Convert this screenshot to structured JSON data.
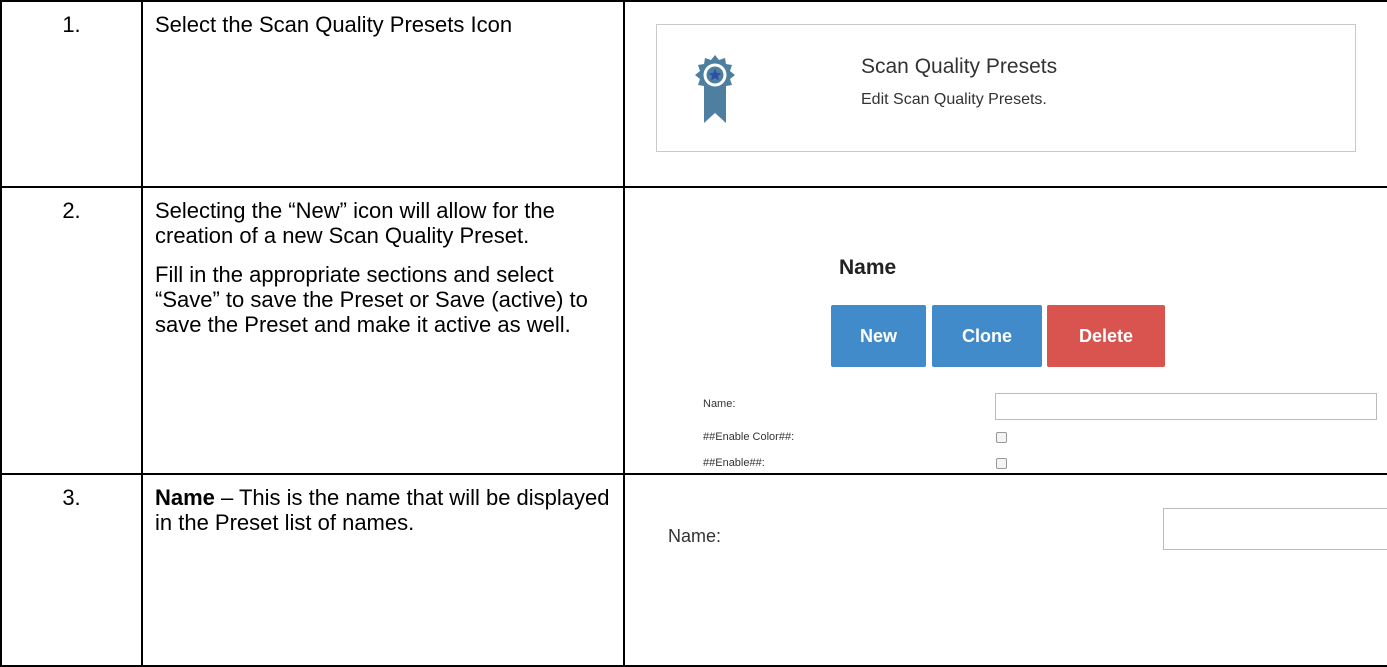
{
  "rows": [
    {
      "num": "1.",
      "desc": "Select the Scan Quality Presets Icon",
      "card": {
        "title": "Scan Quality Presets",
        "subtitle": "Edit Scan Quality Presets.",
        "icon": "ribbon-star-badge-icon"
      }
    },
    {
      "num": "2.",
      "desc_p1": "Selecting the “New” icon will allow for the creation of a new Scan Quality Preset.",
      "desc_p2": "Fill in the appropriate sections and select “Save” to save the Preset or Save (active) to save the Preset and make it active as well.",
      "form": {
        "heading": "Name",
        "buttons": {
          "new": "New",
          "clone": "Clone",
          "delete": "Delete"
        },
        "fields": {
          "name": "Name:",
          "enable_color": "##Enable Color##:",
          "enable": "##Enable##:"
        }
      }
    },
    {
      "num": "3.",
      "desc_bold": "Name",
      "desc_rest": " – This is the name that will be displayed in the Preset list of names.",
      "field_label": "Name:"
    }
  ],
  "colors": {
    "primary_button": "#428bca",
    "danger_button": "#d9534f",
    "badge": "#4f7fa0",
    "badge_star": "#2c4fa8"
  }
}
